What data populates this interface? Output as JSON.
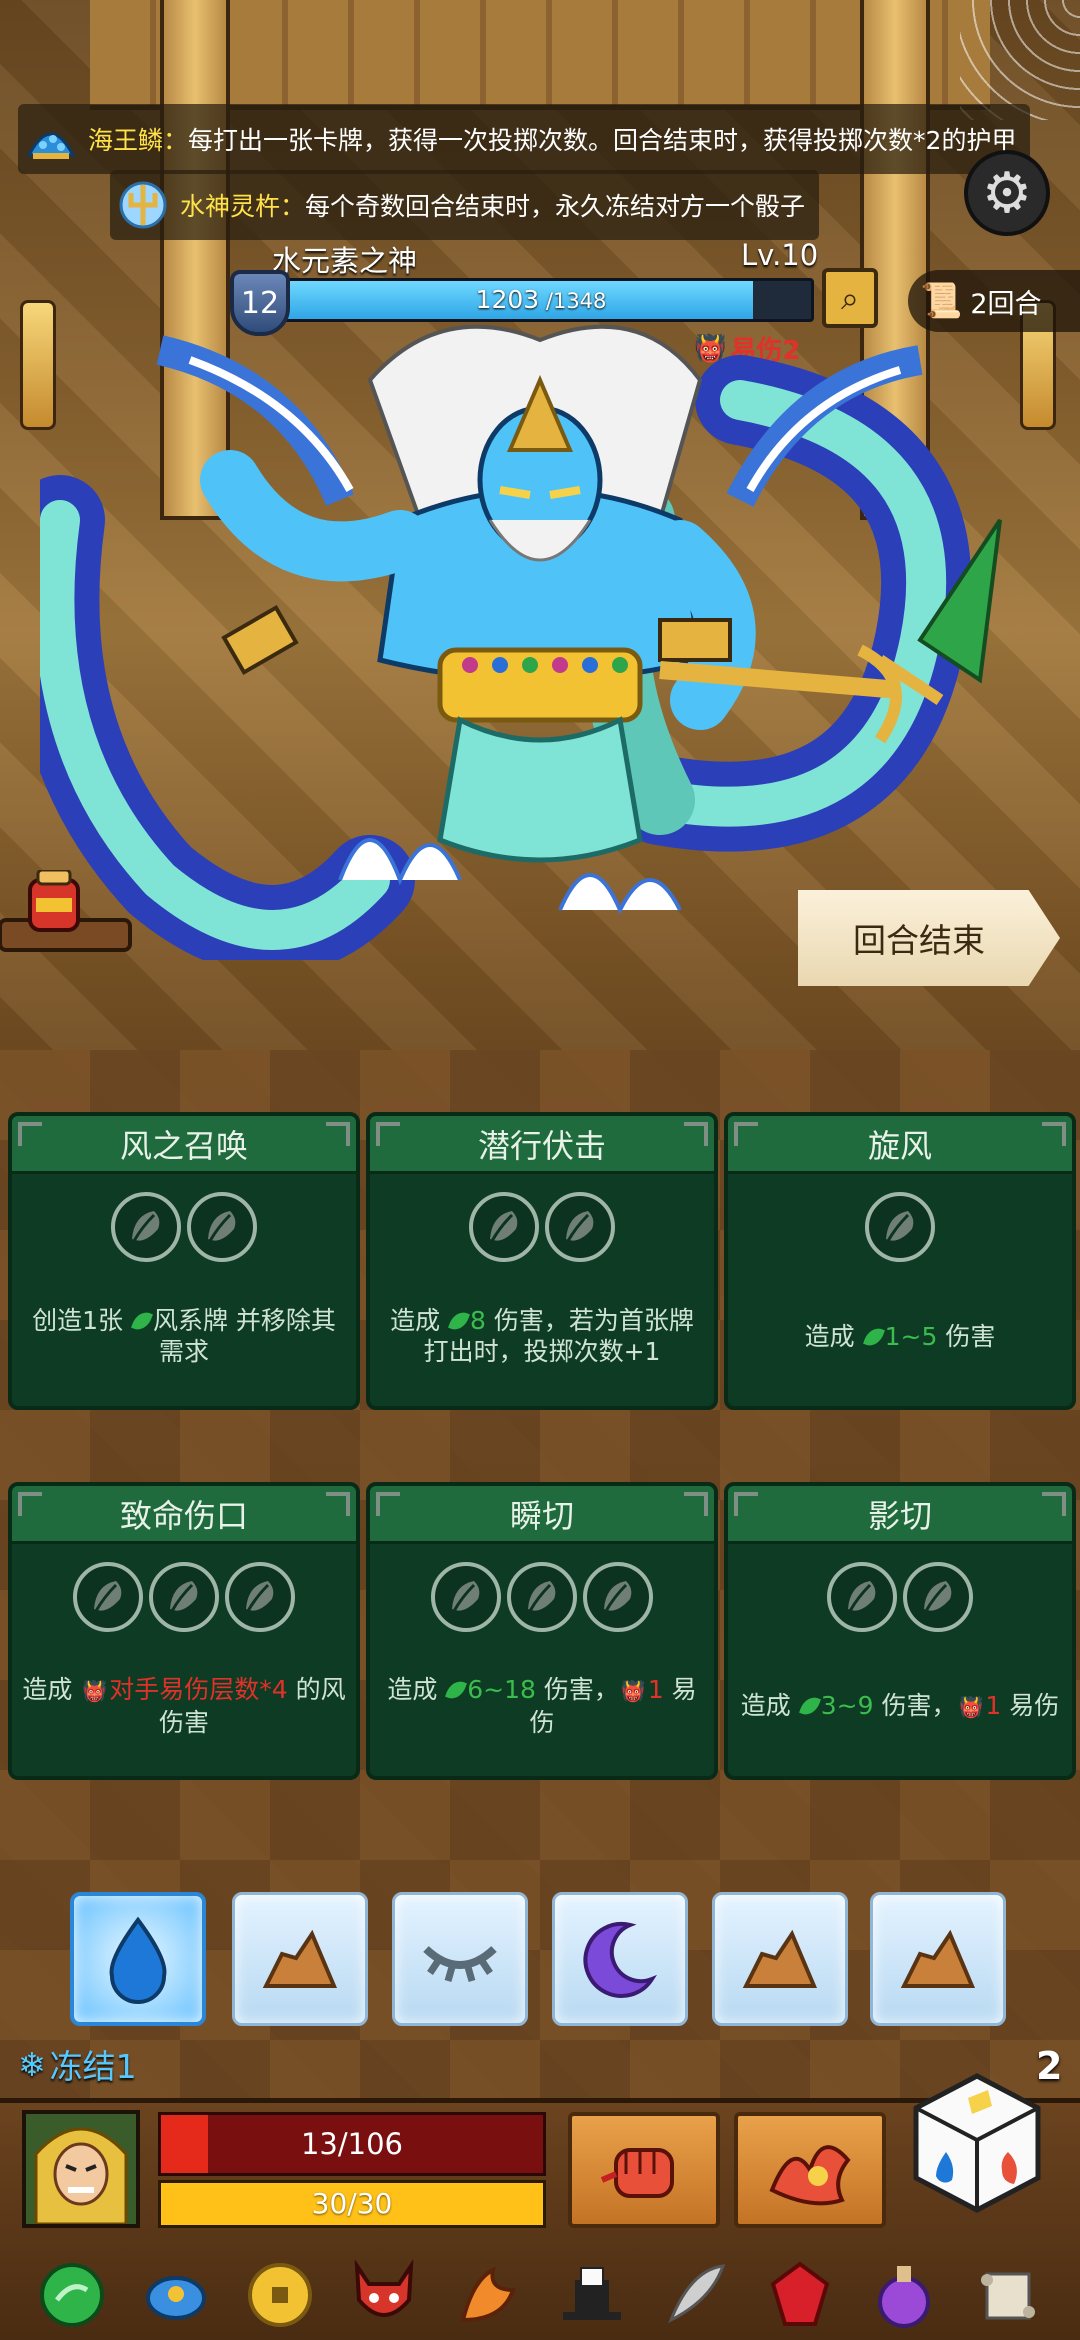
{
  "relics_top": [
    {
      "name": "海王鳞",
      "sep": "：",
      "desc": "每打出一张卡牌，获得一次投掷次数。回合结束时，获得投掷次数*2的护甲",
      "icon": "scale-icon"
    },
    {
      "name": "水神灵杵",
      "sep": "：",
      "desc": "每个奇数回合结束时，永久冻结对方一个骰子",
      "icon": "trident-icon"
    }
  ],
  "enemy": {
    "name": "水元素之神",
    "level": "Lv.10",
    "shield": "12",
    "hp_current": "1203",
    "hp_max": " /1348",
    "hp_fraction": 0.8925,
    "vulnerable_label": "易伤2"
  },
  "round": {
    "label": "2回合"
  },
  "end_turn": {
    "label": "回合结束"
  },
  "cards": [
    {
      "title": "风之召唤",
      "cost": 2,
      "desc_parts": [
        {
          "t": "创造1张 "
        },
        {
          "leaf": true
        },
        {
          "t": "风系牌 并移除其需求"
        }
      ]
    },
    {
      "title": "潜行伏击",
      "cost": 2,
      "desc_parts": [
        {
          "t": "造成 "
        },
        {
          "leaf": true
        },
        {
          "t": "8",
          "c": "green"
        },
        {
          "t": " 伤害，若为首张牌打出时，投掷次数+1"
        }
      ]
    },
    {
      "title": "旋风",
      "cost": 1,
      "desc_parts": [
        {
          "t": "造成 "
        },
        {
          "leaf": true
        },
        {
          "t": "1~5",
          "c": "green"
        },
        {
          "t": " 伤害"
        }
      ]
    },
    {
      "title": "致命伤口",
      "cost": 3,
      "desc_parts": [
        {
          "t": "造成 "
        },
        {
          "demon": true
        },
        {
          "t": "对手易伤层数*4",
          "c": "red"
        },
        {
          "t": " 的风伤害"
        }
      ]
    },
    {
      "title": "瞬切",
      "cost": 3,
      "desc_parts": [
        {
          "t": "造成 "
        },
        {
          "leaf": true
        },
        {
          "t": "6~18",
          "c": "green"
        },
        {
          "t": " 伤害，"
        },
        {
          "demon": true
        },
        {
          "t": "1",
          "c": "red"
        },
        {
          "t": " 易伤"
        }
      ]
    },
    {
      "title": "影切",
      "cost": 2,
      "desc_parts": [
        {
          "t": "造成 "
        },
        {
          "leaf": true
        },
        {
          "t": "3~9",
          "c": "green"
        },
        {
          "t": " 伤害，"
        },
        {
          "demon": true
        },
        {
          "t": "1",
          "c": "red"
        },
        {
          "t": " 易伤"
        }
      ]
    }
  ],
  "dice": [
    {
      "icon": "water-drop-icon",
      "selected": true
    },
    {
      "icon": "rock-icon"
    },
    {
      "icon": "closed-eye-icon"
    },
    {
      "icon": "moon-icon"
    },
    {
      "icon": "rock-icon"
    },
    {
      "icon": "rock-icon"
    }
  ],
  "status": {
    "freeze_label": "冻结1"
  },
  "dice_remaining": "2",
  "player": {
    "hp_text": "13/106",
    "hp_fraction": 0.1226,
    "energy_text": "30/30",
    "energy_fraction": 1.0
  },
  "skills": [
    {
      "icon": "fist-icon"
    },
    {
      "icon": "flame-burst-icon"
    }
  ],
  "relic_bar": [
    "wind-orb-icon",
    "blue-bird-icon",
    "gold-coin-icon",
    "demon-mask-icon",
    "fire-sword-icon",
    "magic-hat-icon",
    "feather-icon",
    "ruby-icon",
    "potion-icon",
    "scroll-icon"
  ],
  "colors": {
    "accent_blue": "#4fc3f7",
    "card_green": "#0e3b23",
    "highlight_green": "#3bbd4e",
    "highlight_red": "#e0312a",
    "gold": "#ffe24a"
  }
}
